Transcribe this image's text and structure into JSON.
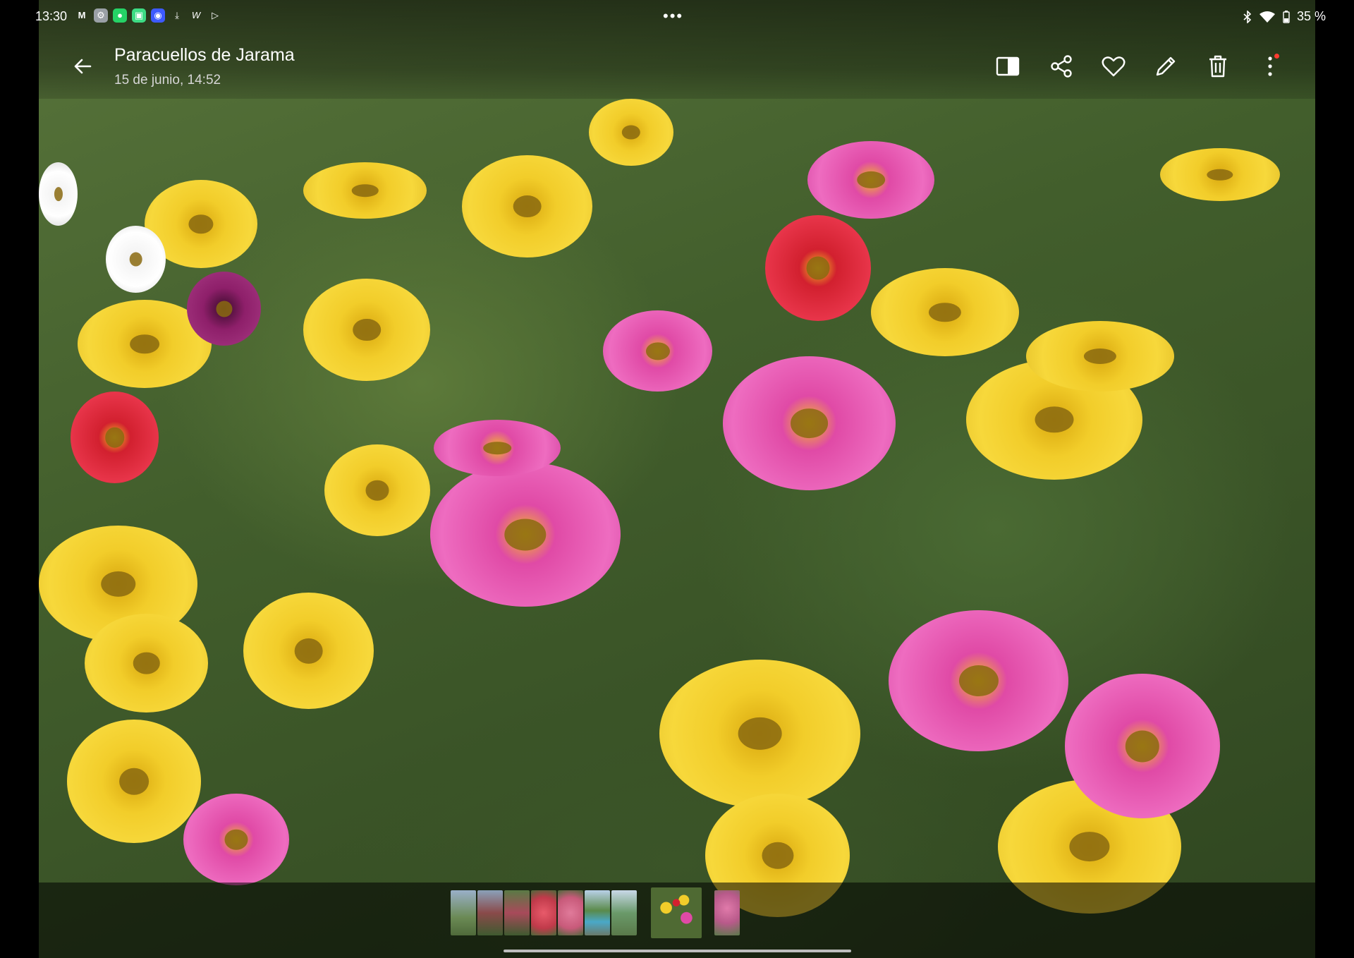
{
  "status_bar": {
    "time": "13:30",
    "notification_icons": [
      "gmail-icon",
      "settings-app-icon",
      "whatsapp-icon",
      "app-icon",
      "radio-icon",
      "download-icon",
      "w-icon",
      "play-icon"
    ],
    "more_dots": "•••",
    "battery": "35 %",
    "right_icons": [
      "bluetooth-icon",
      "wifi-icon",
      "battery-icon"
    ]
  },
  "header": {
    "title": "Paracuellos de Jarama",
    "subtitle": "15 de junio, 14:52"
  },
  "actions": [
    "split-view-icon",
    "share-icon",
    "favorite-icon",
    "edit-icon",
    "delete-icon",
    "more-options-icon"
  ],
  "filmstrip": {
    "thumbnails": [
      {
        "name": "thumb-1",
        "color": "#6b8a55"
      },
      {
        "name": "thumb-2",
        "color": "#8a4a4a"
      },
      {
        "name": "thumb-3",
        "color": "#a84a5a"
      },
      {
        "name": "thumb-4",
        "color": "#d64a5a"
      },
      {
        "name": "thumb-5",
        "color": "#c85a7a"
      },
      {
        "name": "thumb-6",
        "color": "#5a8aa8"
      },
      {
        "name": "thumb-7",
        "color": "#6a9a6a"
      },
      {
        "name": "thumb-current",
        "color": "#b89a3a"
      },
      {
        "name": "thumb-9",
        "color": "#b85a8a"
      }
    ]
  }
}
